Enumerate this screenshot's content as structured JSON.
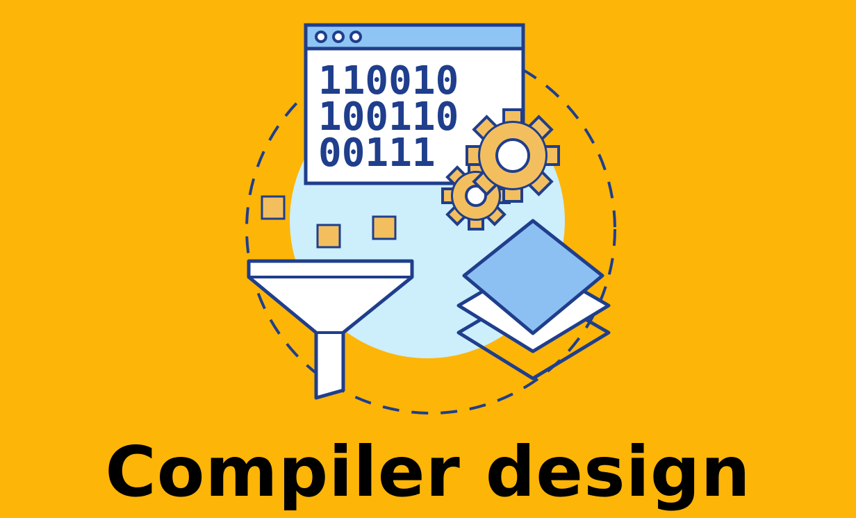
{
  "title": "Compiler design",
  "binary_lines": [
    "110010",
    "100110",
    "00111"
  ],
  "colors": {
    "background": "#FDB508",
    "outline": "#1F3E8C",
    "light_blue": "#CDEEFB",
    "window_bar": "#8EC5F4",
    "diamond_fill": "#8CC0F2",
    "gear_fill": "#F3BF5E",
    "accent_squares": "#F3BF5E"
  },
  "icons": [
    "browser-window-icon",
    "gear-icon",
    "funnel-icon",
    "layers-icon"
  ]
}
